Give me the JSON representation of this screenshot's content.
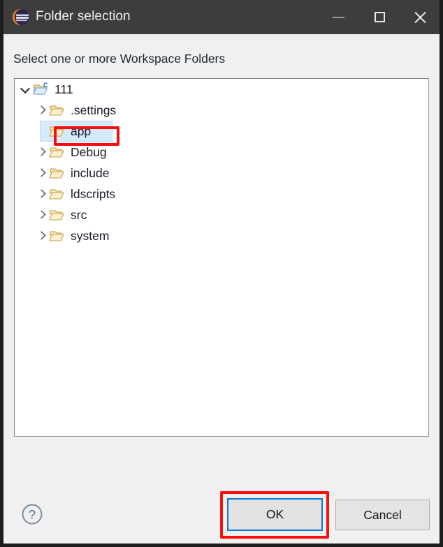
{
  "window": {
    "title": "Folder selection",
    "app_icon": "eclipse-icon",
    "controls": {
      "minimize": "minimize",
      "maximize": "maximize",
      "close": "close"
    }
  },
  "prompt": "Select one or more Workspace Folders",
  "tree": {
    "items": [
      {
        "label": "111",
        "icon": "c-project-folder-icon",
        "expanded": true,
        "has_children": true,
        "depth": 0,
        "selected": false
      },
      {
        "label": ".settings",
        "icon": "folder-icon",
        "expanded": false,
        "has_children": true,
        "depth": 1,
        "selected": false
      },
      {
        "label": "app",
        "icon": "folder-icon",
        "expanded": false,
        "has_children": false,
        "depth": 1,
        "selected": true
      },
      {
        "label": "Debug",
        "icon": "folder-icon",
        "expanded": false,
        "has_children": true,
        "depth": 1,
        "selected": false
      },
      {
        "label": "include",
        "icon": "folder-icon",
        "expanded": false,
        "has_children": true,
        "depth": 1,
        "selected": false
      },
      {
        "label": "ldscripts",
        "icon": "folder-icon",
        "expanded": false,
        "has_children": true,
        "depth": 1,
        "selected": false
      },
      {
        "label": "src",
        "icon": "folder-icon",
        "expanded": false,
        "has_children": true,
        "depth": 1,
        "selected": false
      },
      {
        "label": "system",
        "icon": "folder-icon",
        "expanded": false,
        "has_children": true,
        "depth": 1,
        "selected": false
      }
    ]
  },
  "footer": {
    "help_icon": "help-circle-icon",
    "ok_label": "OK",
    "cancel_label": "Cancel"
  },
  "annotations": {
    "highlight_color": "#fc0d0d",
    "selection_color": "#d5eafb",
    "focus_color": "#1277d3",
    "titlebar_color": "#3d3d3d"
  }
}
